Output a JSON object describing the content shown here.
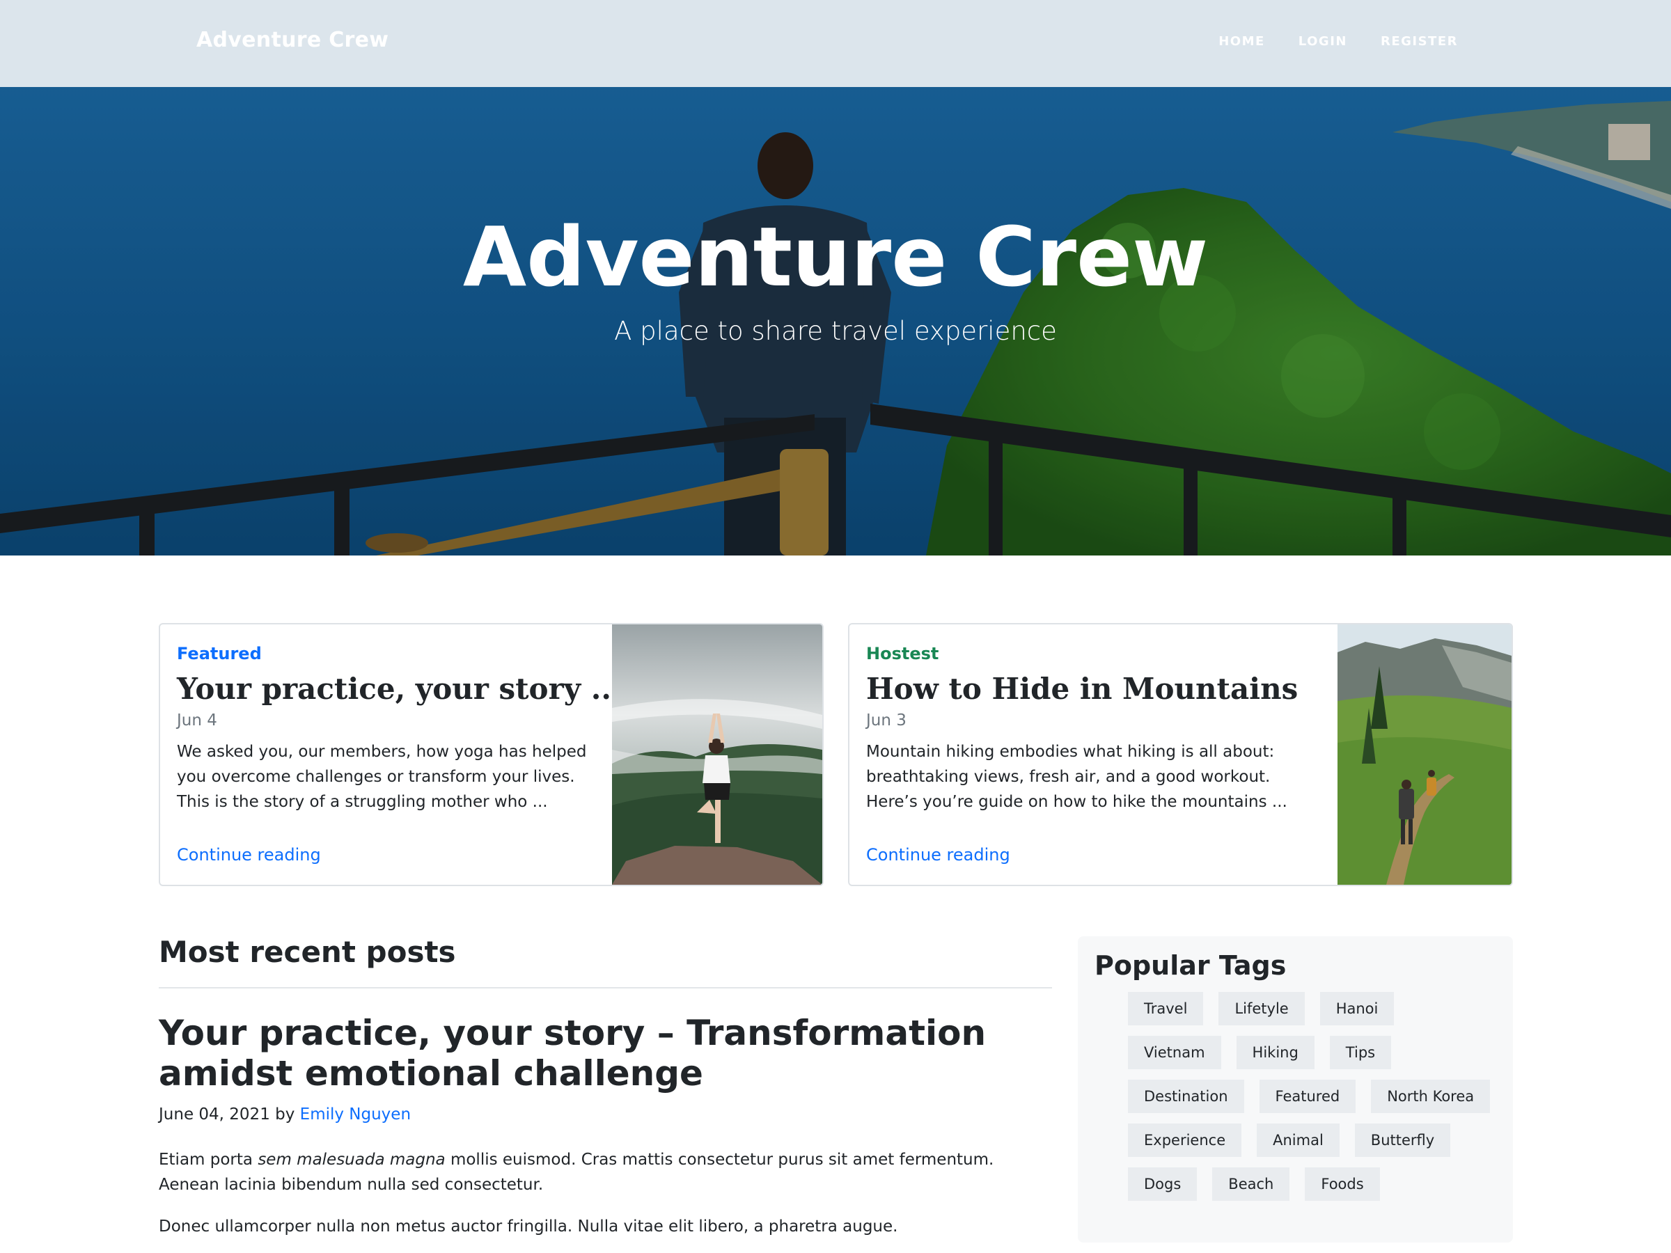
{
  "navbar": {
    "brand": "Adventure Crew",
    "links": [
      "HOME",
      "LOGIN",
      "REGISTER"
    ]
  },
  "hero": {
    "title": "Adventure Crew",
    "subtitle": "A place to share travel experience"
  },
  "featured_cards": [
    {
      "kicker": "Featured",
      "title": "Your practice, your story ...",
      "date": "Jun 4",
      "excerpt": "We asked you, our members, how yoga has helped you overcome challenges or transform your lives. This is the story of a struggling mother who ...",
      "link": "Continue reading"
    },
    {
      "kicker": "Hostest",
      "title": "How to Hide in Mountains",
      "date": "Jun 3",
      "excerpt": "Mountain hiking embodies what hiking is all about: breathtaking views, fresh air, and a good workout. Here’s you’re guide on how to hike the mountains ...",
      "link": "Continue reading"
    }
  ],
  "recent": {
    "heading": "Most recent posts",
    "post": {
      "title": "Your practice, your story – Transformation amidst emotional challenge",
      "date_prefix": "June 04, 2021 by ",
      "author": "Emily Nguyen",
      "para1_a": "Etiam porta ",
      "para1_em": "sem malesuada magna",
      "para1_b": " mollis euismod. Cras mattis consectetur purus sit amet fermentum. Aenean lacinia bibendum nulla sed consectetur.",
      "para2": "Donec ullamcorper nulla non metus auctor fringilla. Nulla vitae elit libero, a pharetra augue."
    }
  },
  "sidebar": {
    "heading": "Popular Tags",
    "tags": [
      "Travel",
      "Lifetyle",
      "Hanoi",
      "Vietnam",
      "Hiking",
      "Tips",
      "Destination",
      "Featured",
      "North Korea",
      "Experience",
      "Animal",
      "Butterfly",
      "Dogs",
      "Beach",
      "Foods"
    ]
  },
  "colors": {
    "link_blue": "#0d6efd",
    "hostest_green": "#198754",
    "navbar_bg": "#e2e9ee",
    "tag_bg": "#e9ecef"
  }
}
